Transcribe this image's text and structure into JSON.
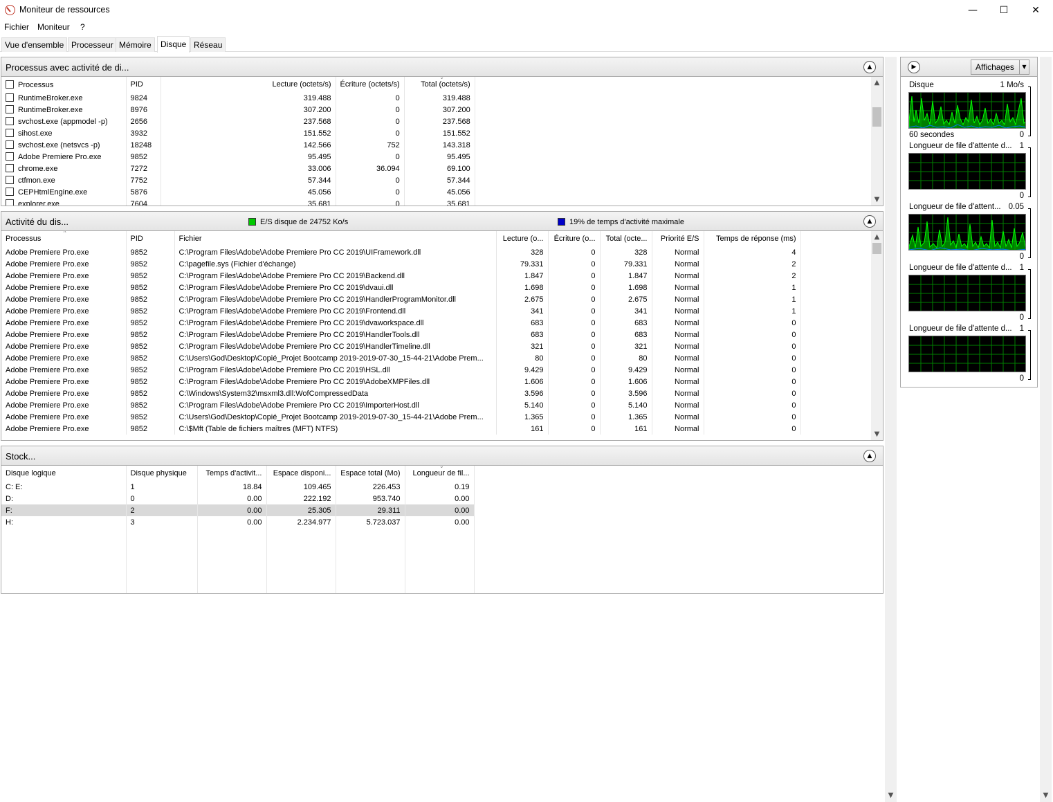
{
  "window": {
    "title": "Moniteur de ressources",
    "min": "—",
    "max": "☐",
    "close": "✕"
  },
  "menu": [
    "Fichier",
    "Moniteur",
    "?"
  ],
  "tabs": [
    "Vue d'ensemble",
    "Processeur",
    "Mémoire",
    "Disque",
    "Réseau"
  ],
  "active_tab": "Disque",
  "processes_panel": {
    "title": "Processus avec activité de di...",
    "columns": [
      "Processus",
      "PID",
      "Lecture (octets/s)",
      "Écriture (octets/s)",
      "Total (octets/s)"
    ],
    "rows": [
      [
        "RuntimeBroker.exe",
        "9824",
        "319.488",
        "0",
        "319.488"
      ],
      [
        "RuntimeBroker.exe",
        "8976",
        "307.200",
        "0",
        "307.200"
      ],
      [
        "svchost.exe (appmodel -p)",
        "2656",
        "237.568",
        "0",
        "237.568"
      ],
      [
        "sihost.exe",
        "3932",
        "151.552",
        "0",
        "151.552"
      ],
      [
        "svchost.exe (netsvcs -p)",
        "18248",
        "142.566",
        "752",
        "143.318"
      ],
      [
        "Adobe Premiere Pro.exe",
        "9852",
        "95.495",
        "0",
        "95.495"
      ],
      [
        "chrome.exe",
        "7272",
        "33.006",
        "36.094",
        "69.100"
      ],
      [
        "ctfmon.exe",
        "7752",
        "57.344",
        "0",
        "57.344"
      ],
      [
        "CEPHtmlEngine.exe",
        "5876",
        "45.056",
        "0",
        "45.056"
      ],
      [
        "explorer.exe",
        "7604",
        "35.681",
        "0",
        "35.681"
      ]
    ]
  },
  "disk_activity_panel": {
    "title": "Activité du dis...",
    "legend_green": "E/S disque de 24752 Ko/s",
    "legend_blue": "19% de temps d'activité maximale",
    "green_color": "#00c800",
    "blue_color": "#0000c8",
    "columns": [
      "Processus",
      "PID",
      "Fichier",
      "Lecture (o...",
      "Écriture (o...",
      "Total (octe...",
      "Priorité E/S",
      "Temps de réponse (ms)"
    ],
    "rows": [
      [
        "Adobe Premiere Pro.exe",
        "9852",
        "C:\\Program Files\\Adobe\\Adobe Premiere Pro CC 2019\\UIFramework.dll",
        "328",
        "0",
        "328",
        "Normal",
        "4"
      ],
      [
        "Adobe Premiere Pro.exe",
        "9852",
        "C:\\pagefile.sys (Fichier d'échange)",
        "79.331",
        "0",
        "79.331",
        "Normal",
        "2"
      ],
      [
        "Adobe Premiere Pro.exe",
        "9852",
        "C:\\Program Files\\Adobe\\Adobe Premiere Pro CC 2019\\Backend.dll",
        "1.847",
        "0",
        "1.847",
        "Normal",
        "2"
      ],
      [
        "Adobe Premiere Pro.exe",
        "9852",
        "C:\\Program Files\\Adobe\\Adobe Premiere Pro CC 2019\\dvaui.dll",
        "1.698",
        "0",
        "1.698",
        "Normal",
        "1"
      ],
      [
        "Adobe Premiere Pro.exe",
        "9852",
        "C:\\Program Files\\Adobe\\Adobe Premiere Pro CC 2019\\HandlerProgramMonitor.dll",
        "2.675",
        "0",
        "2.675",
        "Normal",
        "1"
      ],
      [
        "Adobe Premiere Pro.exe",
        "9852",
        "C:\\Program Files\\Adobe\\Adobe Premiere Pro CC 2019\\Frontend.dll",
        "341",
        "0",
        "341",
        "Normal",
        "1"
      ],
      [
        "Adobe Premiere Pro.exe",
        "9852",
        "C:\\Program Files\\Adobe\\Adobe Premiere Pro CC 2019\\dvaworkspace.dll",
        "683",
        "0",
        "683",
        "Normal",
        "0"
      ],
      [
        "Adobe Premiere Pro.exe",
        "9852",
        "C:\\Program Files\\Adobe\\Adobe Premiere Pro CC 2019\\HandlerTools.dll",
        "683",
        "0",
        "683",
        "Normal",
        "0"
      ],
      [
        "Adobe Premiere Pro.exe",
        "9852",
        "C:\\Program Files\\Adobe\\Adobe Premiere Pro CC 2019\\HandlerTimeline.dll",
        "321",
        "0",
        "321",
        "Normal",
        "0"
      ],
      [
        "Adobe Premiere Pro.exe",
        "9852",
        "C:\\Users\\God\\Desktop\\Copié_Projet Bootcamp 2019-2019-07-30_15-44-21\\Adobe Prem...",
        "80",
        "0",
        "80",
        "Normal",
        "0"
      ],
      [
        "Adobe Premiere Pro.exe",
        "9852",
        "C:\\Program Files\\Adobe\\Adobe Premiere Pro CC 2019\\HSL.dll",
        "9.429",
        "0",
        "9.429",
        "Normal",
        "0"
      ],
      [
        "Adobe Premiere Pro.exe",
        "9852",
        "C:\\Program Files\\Adobe\\Adobe Premiere Pro CC 2019\\AdobeXMPFiles.dll",
        "1.606",
        "0",
        "1.606",
        "Normal",
        "0"
      ],
      [
        "Adobe Premiere Pro.exe",
        "9852",
        "C:\\Windows\\System32\\msxml3.dll:WofCompressedData",
        "3.596",
        "0",
        "3.596",
        "Normal",
        "0"
      ],
      [
        "Adobe Premiere Pro.exe",
        "9852",
        "C:\\Program Files\\Adobe\\Adobe Premiere Pro CC 2019\\ImporterHost.dll",
        "5.140",
        "0",
        "5.140",
        "Normal",
        "0"
      ],
      [
        "Adobe Premiere Pro.exe",
        "9852",
        "C:\\Users\\God\\Desktop\\Copié_Projet Bootcamp 2019-2019-07-30_15-44-21\\Adobe Prem...",
        "1.365",
        "0",
        "1.365",
        "Normal",
        "0"
      ],
      [
        "Adobe Premiere Pro.exe",
        "9852",
        "C:\\$Mft (Table de fichiers maîtres (MFT) NTFS)",
        "161",
        "0",
        "161",
        "Normal",
        "0"
      ]
    ]
  },
  "storage_panel": {
    "title": "Stock...",
    "columns": [
      "Disque logique",
      "Disque physique",
      "Temps d'activit...",
      "Espace disponi...",
      "Espace total (Mo)",
      "Longueur de fil..."
    ],
    "rows": [
      [
        "C: E:",
        "1",
        "18.84",
        "109.465",
        "226.453",
        "0.19"
      ],
      [
        "D:",
        "0",
        "0.00",
        "222.192",
        "953.740",
        "0.00"
      ],
      [
        "F:",
        "2",
        "0.00",
        "25.305",
        "29.311",
        "0.00"
      ],
      [
        "H:",
        "3",
        "0.00",
        "2.234.977",
        "5.723.037",
        "0.00"
      ]
    ],
    "selected_row": 2
  },
  "side_panel": {
    "views_label": "Affichages",
    "graphs": [
      {
        "label": "Disque",
        "max": "1 Mo/s",
        "min": "0",
        "time": "60 secondes"
      },
      {
        "label": "Longueur de file d'attente d...",
        "max": "1",
        "min": "0"
      },
      {
        "label": "Longueur de file d'attent...",
        "max": "0.05",
        "min": "0"
      },
      {
        "label": "Longueur de file d'attente d...",
        "max": "1",
        "min": "0"
      },
      {
        "label": "Longueur de file d'attente d...",
        "max": "1",
        "min": "0"
      }
    ],
    "graph_colors": {
      "background": "#000000",
      "grid": "#008000",
      "line_green": "#00ff00",
      "line_blue": "#0078ff"
    }
  }
}
